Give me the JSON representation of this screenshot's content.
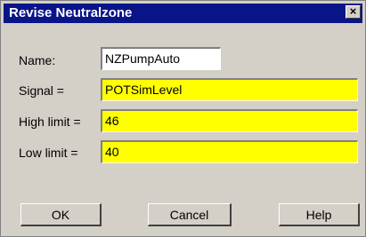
{
  "window": {
    "title": "Revise Neutralzone",
    "close_glyph": "×"
  },
  "form": {
    "name_label": "Name:",
    "name_value": "NZPumpAuto",
    "signal_label": "Signal =",
    "signal_value": "POTSimLevel",
    "high_label": "High limit =",
    "high_value": "46",
    "low_label": "Low limit =",
    "low_value": "40"
  },
  "buttons": {
    "ok": "OK",
    "cancel": "Cancel",
    "help": "Help"
  },
  "colors": {
    "titlebar": "#0a1489",
    "dialog_bg": "#d4d0c8",
    "highlight_field": "#ffff00"
  }
}
